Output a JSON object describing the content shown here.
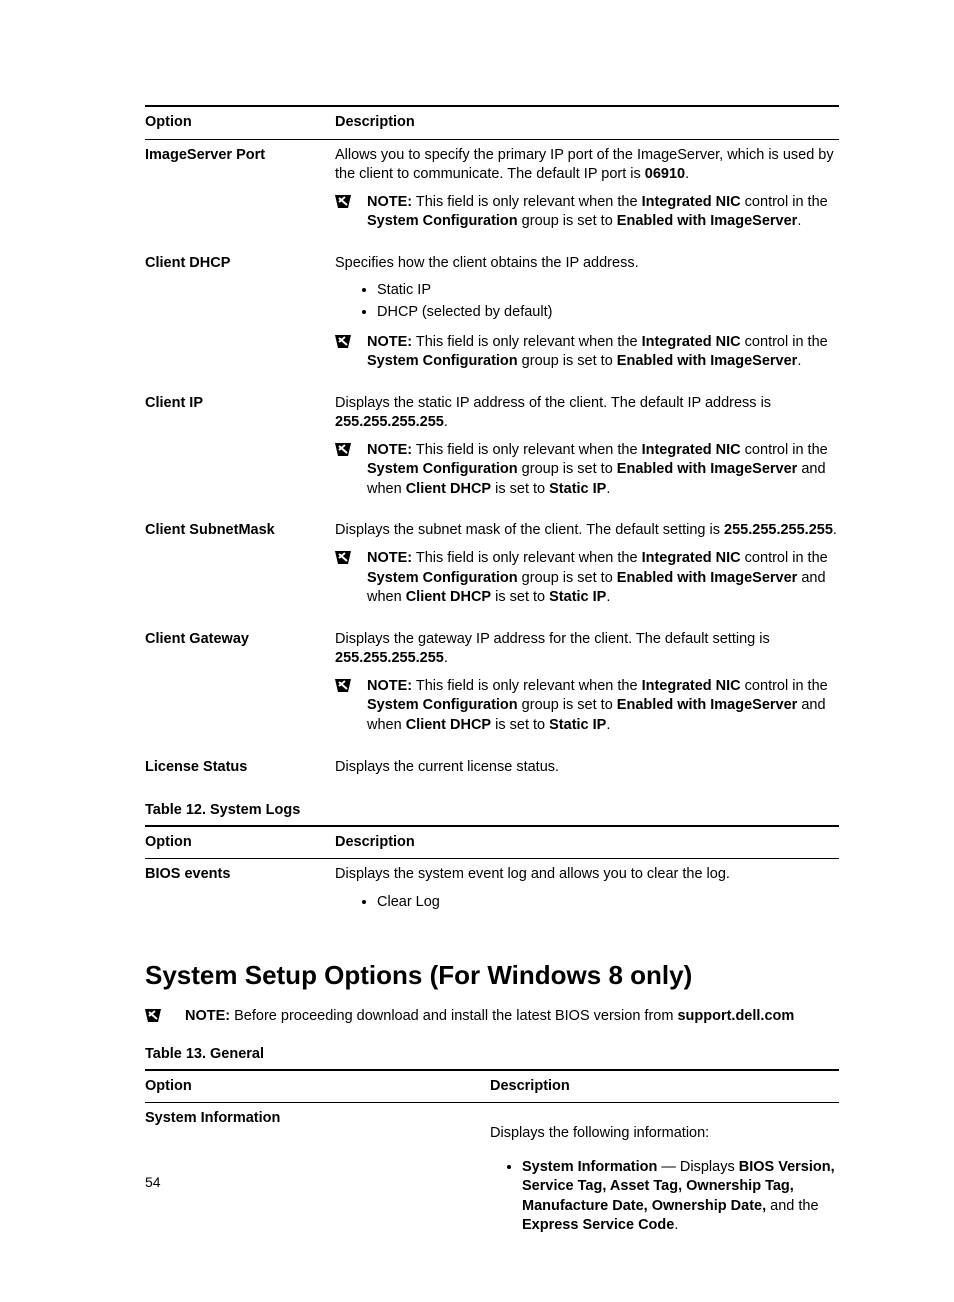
{
  "headers": {
    "option": "Option",
    "description": "Description"
  },
  "rows1": [
    {
      "option": "ImageServer Port",
      "desc_pre": "Allows you to specify the primary IP port of the ImageServer, which is used by the client to communicate. The default IP port is ",
      "desc_bold": "06910",
      "desc_post": ".",
      "note": {
        "pre": "This field is only relevant when the ",
        "b1": "Integrated NIC",
        "mid1": " control in the ",
        "b2": "System Configuration",
        "mid2": " group is set to ",
        "b3": "Enabled with ImageServer",
        "post": "."
      }
    },
    {
      "option": "Client DHCP",
      "desc": "Specifies how the client obtains the IP address.",
      "list": [
        "Static IP",
        "DHCP (selected by default)"
      ],
      "note": {
        "pre": "This field is only relevant when the ",
        "b1": "Integrated NIC",
        "mid1": " control in the ",
        "b2": "System Configuration",
        "mid2": " group is set to ",
        "b3": "Enabled with ImageServer",
        "post": "."
      }
    },
    {
      "option": "Client IP",
      "desc_pre": "Displays the static IP address of the client. The default IP address is ",
      "desc_bold": "255.255.255.255",
      "desc_post": ".",
      "note": {
        "pre": "This field is only relevant when the ",
        "b1": "Integrated NIC",
        "mid1": " control in the ",
        "b2": "System Configuration",
        "mid2": " group is set to ",
        "b3": "Enabled with ImageServer",
        "mid3": " and when ",
        "b4": "Client DHCP",
        "mid4": " is set to ",
        "b5": "Static IP",
        "post": "."
      }
    },
    {
      "option": "Client SubnetMask",
      "desc_pre": "Displays the subnet mask of the client. The default setting is ",
      "desc_bold": "255.255.255.255",
      "desc_post": ".",
      "note": {
        "pre": "This field is only relevant when the ",
        "b1": "Integrated NIC",
        "mid1": " control in the ",
        "b2": "System Configuration",
        "mid2": " group is set to ",
        "b3": "Enabled with ImageServer",
        "mid3": " and when ",
        "b4": "Client DHCP",
        "mid4": " is set to ",
        "b5": "Static IP",
        "post": "."
      }
    },
    {
      "option": "Client Gateway",
      "desc_pre": "Displays the gateway IP address for the client. The default setting is ",
      "desc_bold": "255.255.255.255",
      "desc_post": ".",
      "note": {
        "pre": "This field is only relevant when the ",
        "b1": "Integrated NIC",
        "mid1": " control in the ",
        "b2": "System Configuration",
        "mid2": " group is set to ",
        "b3": "Enabled with ImageServer",
        "mid3": " and when ",
        "b4": "Client DHCP",
        "mid4": " is set to ",
        "b5": "Static IP",
        "post": "."
      }
    },
    {
      "option": "License Status",
      "desc": "Displays the current license status."
    }
  ],
  "table2caption": "Table 12. System Logs",
  "rows2": [
    {
      "option": "BIOS events",
      "desc": "Displays the system event log and allows you to clear the log.",
      "list": [
        "Clear Log"
      ]
    }
  ],
  "sectionHeading": "System Setup Options (For Windows 8 only)",
  "sectionNote": {
    "label": "NOTE:",
    "pre": " Before proceeding download and install the latest BIOS version from ",
    "bold": "support.dell.com"
  },
  "table3caption": "Table 13. General",
  "rows3": [
    {
      "option": "System Information",
      "desc": "Displays the following information:",
      "bullet": {
        "b1": "System Information",
        "sep": " — Displays ",
        "b2": "BIOS Version, Service Tag, Asset Tag, Ownership Tag, Manufacture Date, Ownership Date,",
        "mid": " and the ",
        "b3": "Express Service Code",
        "post": "."
      }
    }
  ],
  "noteLabel": "NOTE:",
  "pageNumber": "54"
}
